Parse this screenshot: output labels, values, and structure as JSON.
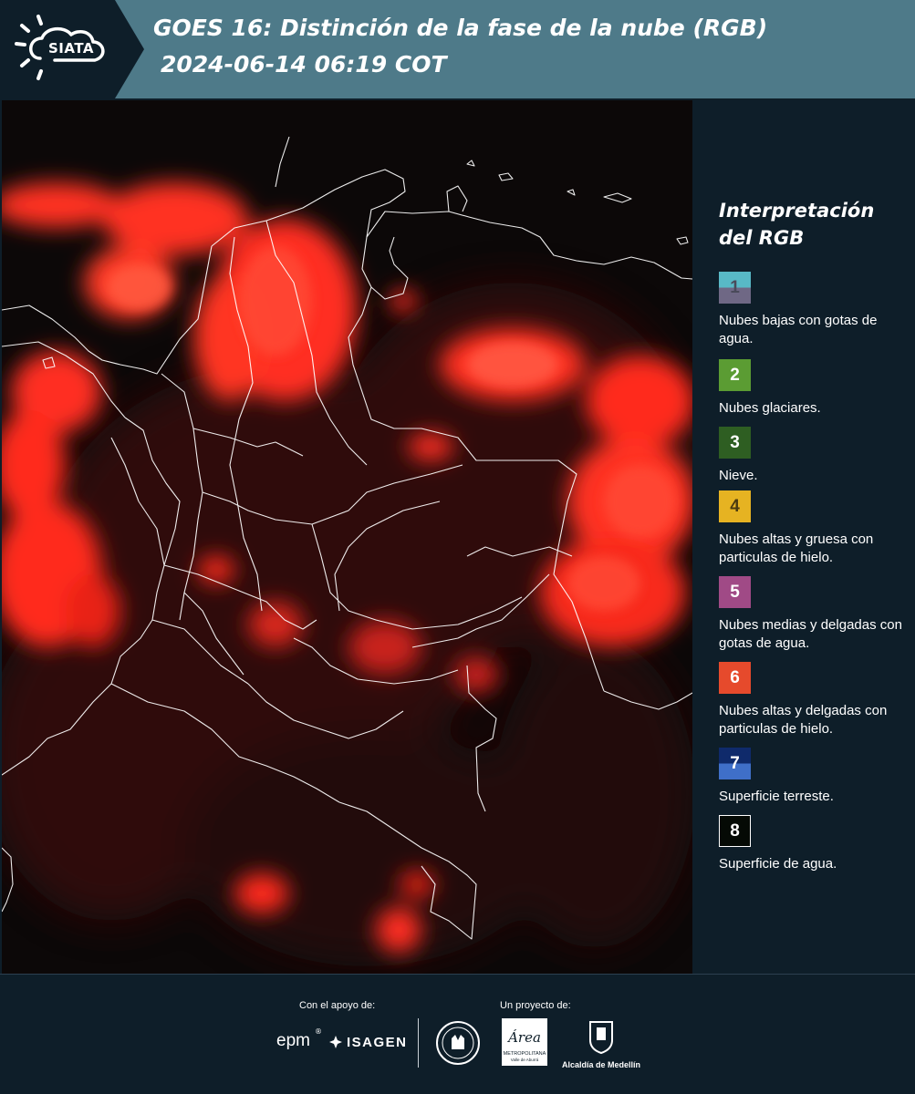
{
  "header": {
    "logo_text": "SIATA",
    "title_line1": "GOES 16: Distinción de la fase de la nube (RGB)",
    "title_line2": "2024-06-14 06:19 COT",
    "colors": {
      "bar": "#4e7a89",
      "logo_block": "#0e1e29"
    }
  },
  "map": {
    "description_icon": "satellite-rgb-map",
    "colors": {
      "cloud": "#ff2b1f",
      "background": "#0c0808",
      "borders": "#ffffff"
    }
  },
  "legend": {
    "title_line1": "Interpretación",
    "title_line2": "del RGB",
    "items": [
      {
        "number": "1",
        "label": "Nubes bajas con gotas de agua.",
        "color_top": "#58b9c6",
        "color_bottom": "#6f6885",
        "num_color": "#4a4a5a"
      },
      {
        "number": "2",
        "label": "Nubes glaciares.",
        "color_top": "#5b9c33",
        "color_bottom": "#5b9c33",
        "num_color": "#ffffff"
      },
      {
        "number": "3",
        "label": "Nieve.",
        "color_top": "#2e5e22",
        "color_bottom": "#2e5e22",
        "num_color": "#ffffff"
      },
      {
        "number": "4",
        "label": "Nubes altas y gruesa con particulas de hielo.",
        "color_top": "#e6b322",
        "color_bottom": "#e6b322",
        "num_color": "#4a3a10"
      },
      {
        "number": "5",
        "label": "Nubes medias y delgadas con gotas de agua.",
        "color_top": "#a04a86",
        "color_bottom": "#a04a86",
        "num_color": "#ffffff"
      },
      {
        "number": "6",
        "label": "Nubes altas y delgadas con particulas de hielo.",
        "color_top": "#e64a2c",
        "color_bottom": "#e64a2c",
        "num_color": "#ffffff"
      },
      {
        "number": "7",
        "label": "Superficie terreste.",
        "color_top": "#0f2a6b",
        "color_bottom": "#3f6fc8",
        "num_color": "#ffffff"
      },
      {
        "number": "8",
        "label": "Superficie de agua.",
        "color_top": "#050a05",
        "color_bottom": "#050a05",
        "num_color": "#ffffff"
      }
    ]
  },
  "footer": {
    "support_label": "Con el apoyo de:",
    "project_label": "Un proyecto de:",
    "epm": "epm",
    "epm_reg": "®",
    "isagen": "ISAGEN",
    "area_text": "Área",
    "area_sub": "METROPOLITANA",
    "area_sub2": "Valle de Aburrá",
    "alcaldia": "Alcaldía de Medellín"
  }
}
